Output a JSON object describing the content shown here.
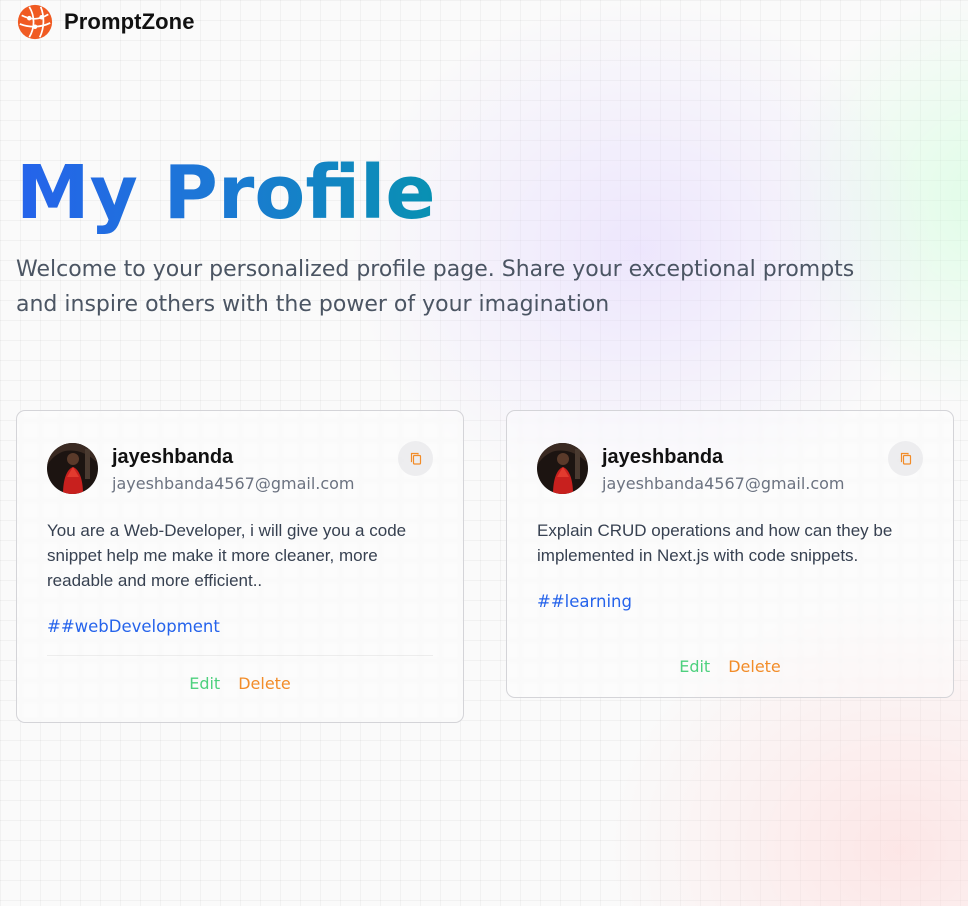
{
  "nav": {
    "brand": "PromptZone",
    "logo_icon": "globe-network-logo-icon"
  },
  "header": {
    "title": "My Profile",
    "description": "Welcome to your personalized profile page. Share your exceptional prompts and inspire others with the power of your imagination"
  },
  "cards": [
    {
      "username": "jayeshbanda",
      "email": "jayeshbanda4567@gmail.com",
      "prompt": "You are a Web-Developer, i will give you a code snippet help me make it more cleaner, more readable and more efficient..",
      "tag": "##webDevelopment",
      "edit_label": "Edit",
      "delete_label": "Delete"
    },
    {
      "username": "jayeshbanda",
      "email": "jayeshbanda4567@gmail.com",
      "prompt": "Explain CRUD operations and how can they be implemented in Next.js with code snippets.",
      "tag": "##learning",
      "edit_label": "Edit",
      "delete_label": "Delete"
    }
  ],
  "colors": {
    "title_gradient_start": "#2563eb",
    "title_gradient_end": "#0891b2",
    "tag": "#2563eb",
    "edit": "#22c55e",
    "delete": "#f28c28",
    "logo": "#f05a22"
  },
  "icons": {
    "copy": "copy-icon"
  }
}
